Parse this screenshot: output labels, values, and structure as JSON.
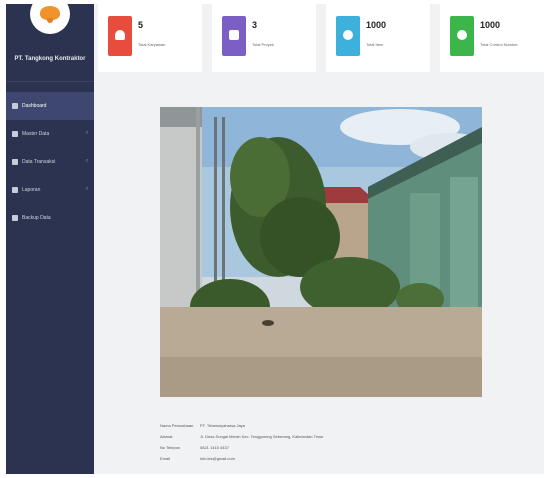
{
  "brand": {
    "name": "PT. Tangkong Kontraktor"
  },
  "sidebar": {
    "items": [
      {
        "label": "Dashboard",
        "icon": "home-icon",
        "has_submenu": false
      },
      {
        "label": "Master Data",
        "icon": "database-icon",
        "has_submenu": true
      },
      {
        "label": "Data Transaksi",
        "icon": "transaction-icon",
        "has_submenu": true
      },
      {
        "label": "Laporan",
        "icon": "report-icon",
        "has_submenu": true
      },
      {
        "label": "Backup Data",
        "icon": "backup-icon",
        "has_submenu": false
      }
    ],
    "arrow_glyph": "‹"
  },
  "stats": [
    {
      "value": "5",
      "label": "Total Karyawan",
      "color": "#e74c3c",
      "icon": "user-icon"
    },
    {
      "value": "3",
      "label": "Total Proyek",
      "color": "#7b5fc4",
      "icon": "project-icon"
    },
    {
      "value": "1000",
      "label": "Total Item",
      "color": "#3eb0dc",
      "icon": "item-icon"
    },
    {
      "value": "1000",
      "label": "Total Control Number",
      "color": "#3cb54a",
      "icon": "control-icon"
    }
  ],
  "company": {
    "rows": [
      {
        "key": "Nama Perusahaan",
        "value": "PT. Tirtamulyaharsa Jaya"
      },
      {
        "key": "Alamat",
        "value": "Jl. Desa Sungai Merah Kec. Tenggarong Seberang, Kalimantan Timur"
      },
      {
        "key": "No Telepon",
        "value": "0821 1415 4437"
      },
      {
        "key": "Email",
        "value": "info.kts@gmail.com"
      }
    ]
  }
}
